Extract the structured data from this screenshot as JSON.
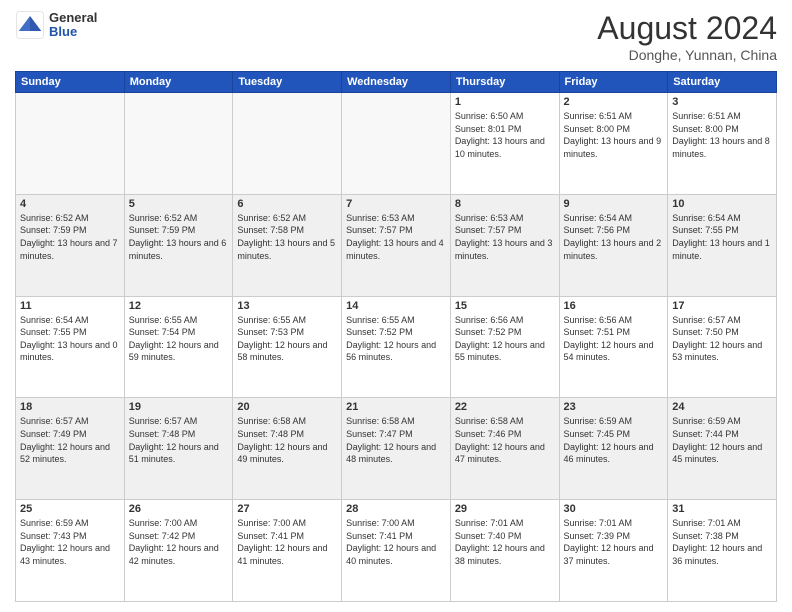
{
  "header": {
    "logo_general": "General",
    "logo_blue": "Blue",
    "month_year": "August 2024",
    "location": "Donghe, Yunnan, China"
  },
  "weekdays": [
    "Sunday",
    "Monday",
    "Tuesday",
    "Wednesday",
    "Thursday",
    "Friday",
    "Saturday"
  ],
  "weeks": [
    [
      {
        "day": "",
        "empty": true
      },
      {
        "day": "",
        "empty": true
      },
      {
        "day": "",
        "empty": true
      },
      {
        "day": "",
        "empty": true
      },
      {
        "day": "1",
        "sunrise": "6:50 AM",
        "sunset": "8:01 PM",
        "daylight": "13 hours and 10 minutes."
      },
      {
        "day": "2",
        "sunrise": "6:51 AM",
        "sunset": "8:00 PM",
        "daylight": "13 hours and 9 minutes."
      },
      {
        "day": "3",
        "sunrise": "6:51 AM",
        "sunset": "8:00 PM",
        "daylight": "13 hours and 8 minutes."
      }
    ],
    [
      {
        "day": "4",
        "sunrise": "6:52 AM",
        "sunset": "7:59 PM",
        "daylight": "13 hours and 7 minutes."
      },
      {
        "day": "5",
        "sunrise": "6:52 AM",
        "sunset": "7:59 PM",
        "daylight": "13 hours and 6 minutes."
      },
      {
        "day": "6",
        "sunrise": "6:52 AM",
        "sunset": "7:58 PM",
        "daylight": "13 hours and 5 minutes."
      },
      {
        "day": "7",
        "sunrise": "6:53 AM",
        "sunset": "7:57 PM",
        "daylight": "13 hours and 4 minutes."
      },
      {
        "day": "8",
        "sunrise": "6:53 AM",
        "sunset": "7:57 PM",
        "daylight": "13 hours and 3 minutes."
      },
      {
        "day": "9",
        "sunrise": "6:54 AM",
        "sunset": "7:56 PM",
        "daylight": "13 hours and 2 minutes."
      },
      {
        "day": "10",
        "sunrise": "6:54 AM",
        "sunset": "7:55 PM",
        "daylight": "13 hours and 1 minute."
      }
    ],
    [
      {
        "day": "11",
        "sunrise": "6:54 AM",
        "sunset": "7:55 PM",
        "daylight": "13 hours and 0 minutes."
      },
      {
        "day": "12",
        "sunrise": "6:55 AM",
        "sunset": "7:54 PM",
        "daylight": "12 hours and 59 minutes."
      },
      {
        "day": "13",
        "sunrise": "6:55 AM",
        "sunset": "7:53 PM",
        "daylight": "12 hours and 58 minutes."
      },
      {
        "day": "14",
        "sunrise": "6:55 AM",
        "sunset": "7:52 PM",
        "daylight": "12 hours and 56 minutes."
      },
      {
        "day": "15",
        "sunrise": "6:56 AM",
        "sunset": "7:52 PM",
        "daylight": "12 hours and 55 minutes."
      },
      {
        "day": "16",
        "sunrise": "6:56 AM",
        "sunset": "7:51 PM",
        "daylight": "12 hours and 54 minutes."
      },
      {
        "day": "17",
        "sunrise": "6:57 AM",
        "sunset": "7:50 PM",
        "daylight": "12 hours and 53 minutes."
      }
    ],
    [
      {
        "day": "18",
        "sunrise": "6:57 AM",
        "sunset": "7:49 PM",
        "daylight": "12 hours and 52 minutes."
      },
      {
        "day": "19",
        "sunrise": "6:57 AM",
        "sunset": "7:48 PM",
        "daylight": "12 hours and 51 minutes."
      },
      {
        "day": "20",
        "sunrise": "6:58 AM",
        "sunset": "7:48 PM",
        "daylight": "12 hours and 49 minutes."
      },
      {
        "day": "21",
        "sunrise": "6:58 AM",
        "sunset": "7:47 PM",
        "daylight": "12 hours and 48 minutes."
      },
      {
        "day": "22",
        "sunrise": "6:58 AM",
        "sunset": "7:46 PM",
        "daylight": "12 hours and 47 minutes."
      },
      {
        "day": "23",
        "sunrise": "6:59 AM",
        "sunset": "7:45 PM",
        "daylight": "12 hours and 46 minutes."
      },
      {
        "day": "24",
        "sunrise": "6:59 AM",
        "sunset": "7:44 PM",
        "daylight": "12 hours and 45 minutes."
      }
    ],
    [
      {
        "day": "25",
        "sunrise": "6:59 AM",
        "sunset": "7:43 PM",
        "daylight": "12 hours and 43 minutes."
      },
      {
        "day": "26",
        "sunrise": "7:00 AM",
        "sunset": "7:42 PM",
        "daylight": "12 hours and 42 minutes."
      },
      {
        "day": "27",
        "sunrise": "7:00 AM",
        "sunset": "7:41 PM",
        "daylight": "12 hours and 41 minutes."
      },
      {
        "day": "28",
        "sunrise": "7:00 AM",
        "sunset": "7:41 PM",
        "daylight": "12 hours and 40 minutes."
      },
      {
        "day": "29",
        "sunrise": "7:01 AM",
        "sunset": "7:40 PM",
        "daylight": "12 hours and 38 minutes."
      },
      {
        "day": "30",
        "sunrise": "7:01 AM",
        "sunset": "7:39 PM",
        "daylight": "12 hours and 37 minutes."
      },
      {
        "day": "31",
        "sunrise": "7:01 AM",
        "sunset": "7:38 PM",
        "daylight": "12 hours and 36 minutes."
      }
    ]
  ]
}
